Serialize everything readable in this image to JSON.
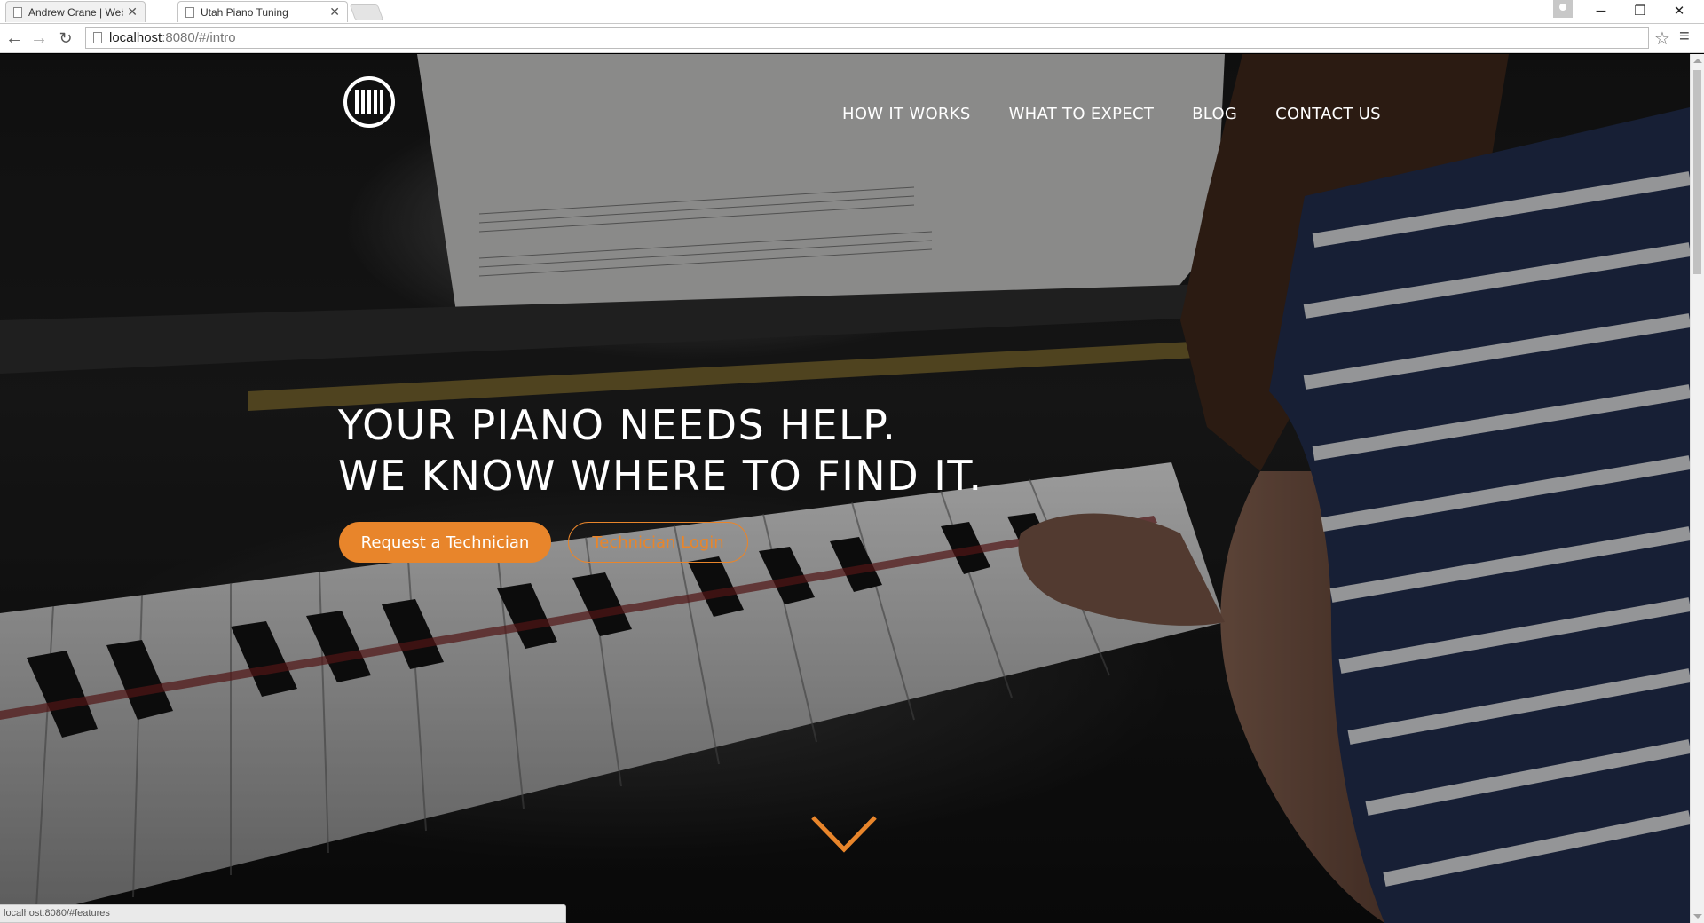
{
  "browser": {
    "tabs": [
      {
        "title": "Andrew Crane | Web Dev",
        "active": false
      },
      {
        "title": "Utah Piano Tuning",
        "active": true
      }
    ],
    "address": {
      "host": "localhost",
      "path": ":8080/#/intro"
    },
    "status_url": "localhost:8080/#features",
    "icons": {
      "back": "back-arrow-icon",
      "forward": "forward-arrow-icon",
      "reload": "reload-icon",
      "bookmark": "star-icon",
      "menu": "hamburger-menu-icon",
      "minimize": "minimize-icon",
      "restore": "restore-icon",
      "close": "close-icon"
    }
  },
  "site": {
    "logo_icon": "piano-keys-logo-icon",
    "nav": [
      {
        "label": "HOW IT WORKS"
      },
      {
        "label": "WHAT TO EXPECT"
      },
      {
        "label": "BLOG"
      },
      {
        "label": "CONTACT US"
      }
    ],
    "hero": {
      "title_line1": "YOUR PIANO NEEDS HELP.",
      "title_line2": "WE KNOW WHERE TO FIND IT.",
      "primary_button": "Request a Technician",
      "secondary_button": "Technician Login",
      "scroll_icon": "chevron-down-icon",
      "background_image": "piano-player-photo"
    },
    "colors": {
      "accent": "#e8852b",
      "text": "#ffffff"
    }
  }
}
